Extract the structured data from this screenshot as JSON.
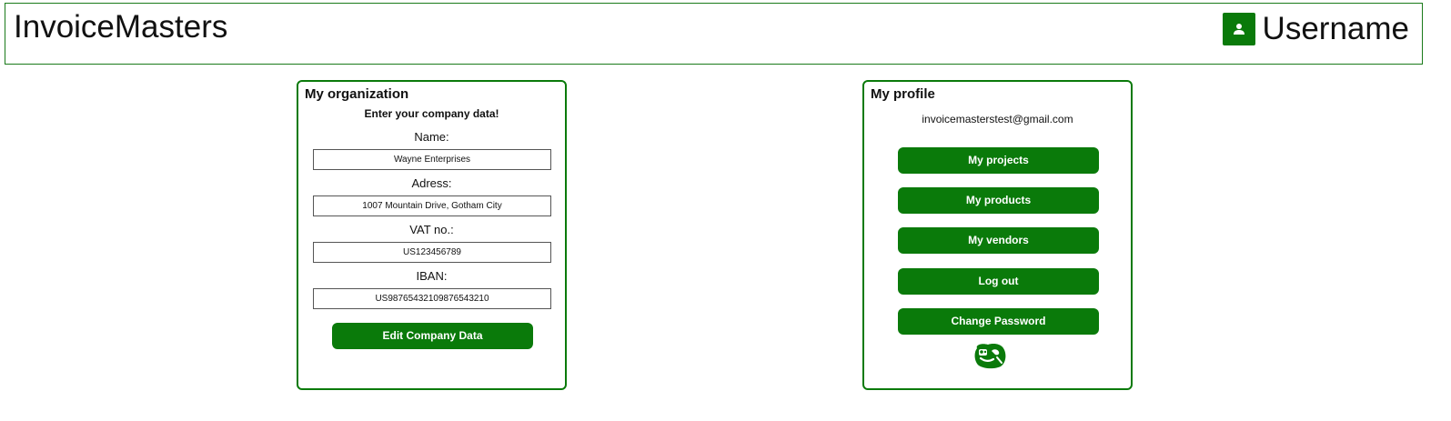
{
  "header": {
    "app_title": "InvoiceMasters",
    "username": "Username",
    "user_icon": "user-icon"
  },
  "organization": {
    "title": "My organization",
    "subtitle": "Enter your company data!",
    "fields": [
      {
        "label": "Name:",
        "value": "Wayne Enterprises"
      },
      {
        "label": "Adress:",
        "value": "1007 Mountain Drive, Gotham City"
      },
      {
        "label": "VAT no.:",
        "value": "US123456789"
      },
      {
        "label": "IBAN:",
        "value": "US98765432109876543210"
      }
    ],
    "edit_button": "Edit Company Data"
  },
  "profile": {
    "title": "My profile",
    "email": "invoicemasterstest@gmail.com",
    "buttons": [
      {
        "label": "My projects"
      },
      {
        "label": "My products"
      },
      {
        "label": "My vendors"
      },
      {
        "label": "Log out"
      },
      {
        "label": "Change Password"
      }
    ],
    "mascot_icon": "mascot-logo-icon"
  },
  "colors": {
    "accent": "#0a7a0a",
    "border": "#1a7a1a"
  }
}
